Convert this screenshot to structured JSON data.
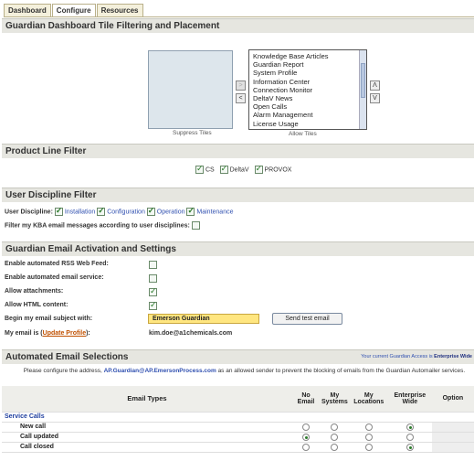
{
  "tabs": [
    {
      "label": "Dashboard"
    },
    {
      "label": "Configure"
    },
    {
      "label": "Resources"
    }
  ],
  "tile_section": {
    "title": "Guardian Dashboard Tile Filtering and Placement",
    "suppress_caption": "Suppress Tiles",
    "allow_caption": "Allow Tiles",
    "allow_items": [
      "Knowledge Base Articles",
      "Guardian Report",
      "System Profile",
      "Information Center",
      "Connection Monitor",
      "DeltaV News",
      "Open Calls",
      "Alarm Management",
      "License Usage"
    ],
    "move_right": ">",
    "move_left": "<",
    "up": "Λ",
    "down": "V"
  },
  "product_section": {
    "title": "Product Line Filter",
    "items": [
      {
        "label": "CS",
        "checked": true
      },
      {
        "label": "DeltaV",
        "checked": true
      },
      {
        "label": "PROVOX",
        "checked": true
      }
    ]
  },
  "discipline_section": {
    "title": "User Discipline Filter",
    "label": "User Discipline:",
    "items": [
      {
        "label": "Installation",
        "checked": true
      },
      {
        "label": "Configuration",
        "checked": true
      },
      {
        "label": "Operation",
        "checked": true
      },
      {
        "label": "Maintenance",
        "checked": true
      }
    ],
    "filter_label": "Filter my KBA email messages according to user disciplines:"
  },
  "email_section": {
    "title": "Guardian Email Activation and Settings",
    "rss_label": "Enable automated RSS Web Feed:",
    "email_label": "Enable automated email service:",
    "attach_label": "Allow attachments:",
    "html_label": "Allow HTML content:",
    "subject_label": "Begin my email subject with:",
    "subject_value": "Emerson Guardian",
    "send_test": "Send test email",
    "email_is_prefix": "My email is (",
    "update_profile": "Update Profile",
    "email_is_suffix": "):",
    "email_value": "kim.doe@a1chemicals.com"
  },
  "auto_section": {
    "title": "Automated Email Selections",
    "access_note_prefix": "Your current Guardian Access is ",
    "access_note_value": "Enterprise Wide",
    "notice_prefix": "Please configure the address, ",
    "notice_address": "AP.Guardian@AP.EmersonProcess.com",
    "notice_suffix": " as an allowed sender to prevent the blocking of emails from the Guardian Automailer services.",
    "columns": [
      "Email Types",
      "No Email",
      "My Systems",
      "My Locations",
      "Enterprise Wide",
      "Option"
    ],
    "group_label": "Service Calls",
    "rows": [
      {
        "label": "New call",
        "selected": 3
      },
      {
        "label": "Call updated",
        "selected": 0
      },
      {
        "label": "Call closed",
        "selected": 3
      }
    ]
  }
}
